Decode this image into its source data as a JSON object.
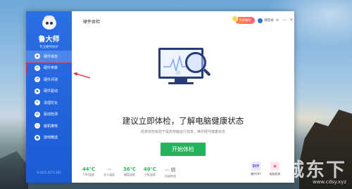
{
  "app": {
    "brand": "鲁大师",
    "brand_sub": "专注硬件防护",
    "window_title": "硬件体检",
    "version": "6.1022.3275.103"
  },
  "titlebar": {
    "promo_label": "大师福利",
    "login_label": "请登录",
    "menu_icon": "≡",
    "minimize_icon": "—",
    "close_icon": "✕"
  },
  "sidebar": {
    "items": [
      {
        "label": "硬件体检",
        "icon": "chip-icon",
        "active": true
      },
      {
        "label": "硬件参数",
        "icon": "list-icon",
        "highlighted": true
      },
      {
        "label": "硬件评测",
        "icon": "benchmark-icon"
      },
      {
        "label": "硬件驱动",
        "icon": "driver-icon"
      },
      {
        "label": "清理优化",
        "icon": "broom-icon"
      },
      {
        "label": "驱动检测",
        "icon": "gear-icon"
      },
      {
        "label": "装机推荐",
        "icon": "cart-icon"
      },
      {
        "label": "游戏精选",
        "icon": "game-icon"
      }
    ]
  },
  "main": {
    "headline": "建议立即体检，了解电脑健康状态",
    "subline": "经常体检有助于提高电脑运行效率，维护硬件健康状态",
    "start_button": "开始体检"
  },
  "stats": [
    {
      "value": "44℃",
      "label": "CPU温度"
    },
    {
      "value": "--",
      "label": "显卡温度"
    },
    {
      "value": "36℃",
      "label": "硬盘温度"
    },
    {
      "value": "40℃",
      "label": "主板温度"
    },
    {
      "value": "-- 转",
      "label": "风扇转速"
    }
  ],
  "tools": [
    {
      "icon_text": "DIY",
      "label": "硬件DIY"
    },
    {
      "icon_text": "▣",
      "label": "电脑相框"
    }
  ],
  "watermark": {
    "big": "城东下",
    "small": "www.cdsy.xyz"
  },
  "colors": {
    "sidebar": "#2b6fe4",
    "accent_green": "#22b45a",
    "highlight_red": "#e03030"
  }
}
